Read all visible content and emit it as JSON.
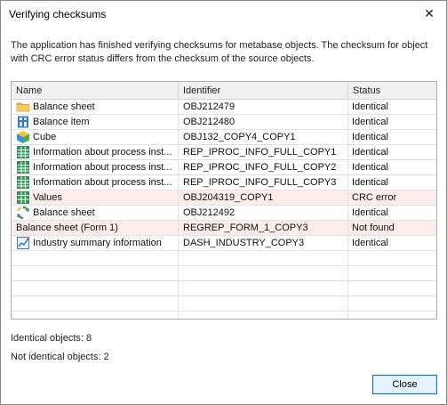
{
  "window": {
    "title": "Verifying checksums",
    "close_glyph": "✕"
  },
  "message": "The application has finished verifying checksums for metabase objects. The checksum for object with CRC error status differs from the checksum of the source objects.",
  "table": {
    "columns": {
      "name": "Name",
      "identifier": "Identifier",
      "status": "Status"
    },
    "rows": [
      {
        "icon": "folder-icon",
        "name": "Balance sheet",
        "identifier": "OBJ212479",
        "status": "Identical",
        "error": false
      },
      {
        "icon": "dictionary-icon",
        "name": "Balance item",
        "identifier": "OBJ212480",
        "status": "Identical",
        "error": false
      },
      {
        "icon": "cube-icon",
        "name": "Cube",
        "identifier": "OBJ132_COPY4_COPY1",
        "status": "Identical",
        "error": false
      },
      {
        "icon": "table-icon",
        "name": "Information about process inst...",
        "identifier": "REP_IPROC_INFO_FULL_COPY1",
        "status": "Identical",
        "error": false
      },
      {
        "icon": "table-icon",
        "name": "Information about process inst...",
        "identifier": "REP_IPROC_INFO_FULL_COPY2",
        "status": "Identical",
        "error": false
      },
      {
        "icon": "table-icon",
        "name": "Information about process inst...",
        "identifier": "REP_IPROC_INFO_FULL_COPY3",
        "status": "Identical",
        "error": false
      },
      {
        "icon": "values-table-icon",
        "name": "Values",
        "identifier": "OBJ204319_COPY1",
        "status": "CRC error",
        "error": true
      },
      {
        "icon": "refresh-icon",
        "name": "Balance sheet",
        "identifier": "OBJ212492",
        "status": "Identical",
        "error": false
      },
      {
        "icon": "",
        "name": "Balance sheet (Form 1)",
        "identifier": "REGREP_FORM_1_COPY3",
        "status": "Not found",
        "error": true
      },
      {
        "icon": "dashboard-icon",
        "name": "Industry summary information",
        "identifier": "DASH_INDUSTRY_COPY3",
        "status": "Identical",
        "error": false
      }
    ]
  },
  "summary": {
    "identical": "Identical objects: 8",
    "not_identical": "Not identical objects: 2"
  },
  "buttons": {
    "close": "Close"
  },
  "colors": {
    "error_row": "#fcecec",
    "button_border": "#0078d7",
    "button_fill": "#e5f1fb"
  }
}
